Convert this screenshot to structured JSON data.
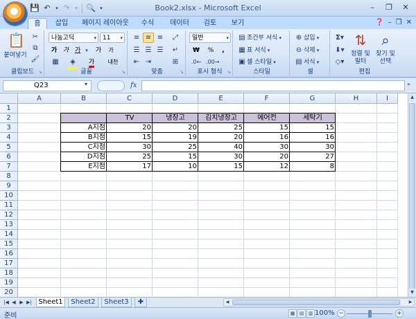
{
  "title": "Book2.xlsx - Microsoft Excel",
  "quick_access": [
    "save-icon",
    "undo-icon",
    "redo-icon",
    "print-preview-icon"
  ],
  "tabs": [
    "홈",
    "삽입",
    "페이지 레이아웃",
    "수식",
    "데이터",
    "검토",
    "보기"
  ],
  "active_tab": "홈",
  "ribbon": {
    "clipboard": {
      "paste": "붙여넣기",
      "label": "클립보드"
    },
    "font": {
      "name": "나눔고딕",
      "size": "11",
      "bold": "가",
      "italic": "가",
      "underline": "가",
      "grow": "가",
      "shrink": "가",
      "fontcolor": "가",
      "phonetic": "내천",
      "label": "글꼴"
    },
    "align": {
      "label": "맞춤"
    },
    "number": {
      "format": "일반",
      "currency": "₩",
      "percent": "%",
      "comma": ",",
      "label": "표시 형식"
    },
    "styles": {
      "conditional": "조건부 서식",
      "table": "표 서식",
      "cell_style": "셀 스타일",
      "label": "스타일"
    },
    "cells": {
      "insert": "삽입",
      "delete": "삭제",
      "format": "서식",
      "label": "셀"
    },
    "editing": {
      "sort": "정렬 및",
      "sort2": "필터",
      "find": "찾기 및",
      "find2": "선택",
      "label": "편집"
    }
  },
  "name_box": "Q23",
  "fx": "fx",
  "formula": "",
  "columns": [
    "A",
    "B",
    "C",
    "D",
    "E",
    "F",
    "G",
    "H",
    "I"
  ],
  "rows": [
    "1",
    "2",
    "3",
    "4",
    "5",
    "6",
    "7",
    "8",
    "9",
    "10",
    "11",
    "12",
    "13",
    "14",
    "15",
    "16",
    "17",
    "18",
    "19",
    "20"
  ],
  "table": {
    "headers": [
      "",
      "TV",
      "냉장고",
      "김치냉장고",
      "에어컨",
      "세탁기"
    ],
    "rows": [
      {
        "label": "A지점",
        "values": [
          "20",
          "20",
          "25",
          "15",
          "15"
        ]
      },
      {
        "label": "B지점",
        "values": [
          "15",
          "19",
          "20",
          "16",
          "16"
        ]
      },
      {
        "label": "C지점",
        "values": [
          "30",
          "25",
          "40",
          "30",
          "30"
        ]
      },
      {
        "label": "D지점",
        "values": [
          "25",
          "15",
          "30",
          "20",
          "27"
        ]
      },
      {
        "label": "E지점",
        "values": [
          "17",
          "10",
          "15",
          "12",
          "8"
        ]
      }
    ],
    "header_color": "#ccc0da"
  },
  "sheets": [
    "Sheet1",
    "Sheet2",
    "Sheet3"
  ],
  "active_sheet": "Sheet1",
  "status": "준비",
  "zoom": "100%"
}
